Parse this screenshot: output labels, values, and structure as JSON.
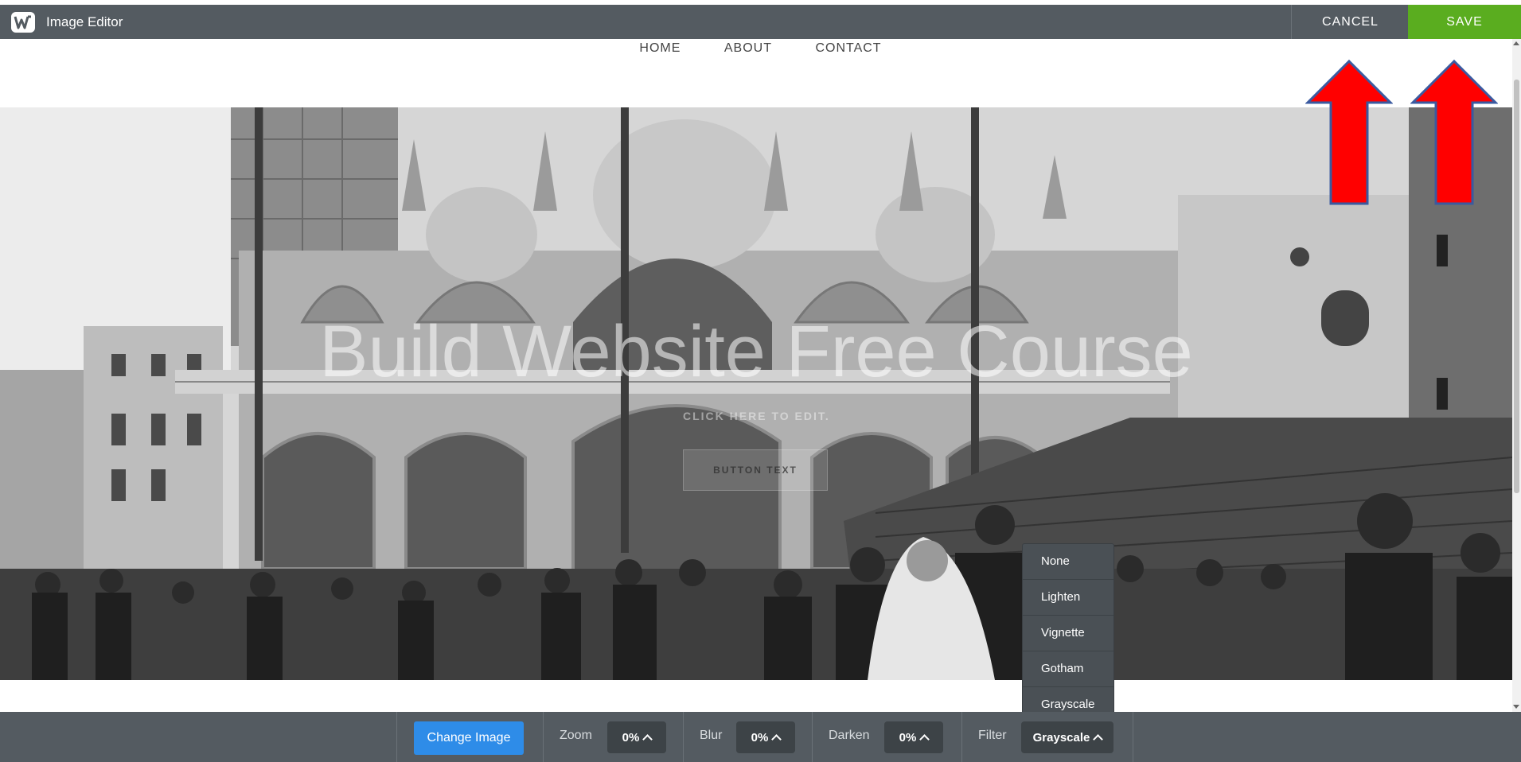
{
  "app": {
    "title": "Image Editor",
    "logo_icon": "weebly-logo-icon"
  },
  "header": {
    "cancel_label": "CANCEL",
    "save_label": "SAVE",
    "save_color": "#5aad1f",
    "bar_color": "#545b61"
  },
  "site_nav": {
    "items": [
      "HOME",
      "ABOUT",
      "CONTACT"
    ]
  },
  "hero": {
    "title": "Build Website Free Course",
    "subtitle": "CLICK HERE TO EDIT.",
    "button_text": "BUTTON TEXT"
  },
  "toolbar": {
    "change_image_label": "Change Image",
    "change_image_color": "#2e8ce8",
    "zoom": {
      "label": "Zoom",
      "value": "0%"
    },
    "blur": {
      "label": "Blur",
      "value": "0%"
    },
    "darken": {
      "label": "Darken",
      "value": "0%"
    },
    "filter": {
      "label": "Filter",
      "value": "Grayscale"
    }
  },
  "filter_menu": {
    "options": [
      "None",
      "Lighten",
      "Vignette",
      "Gotham",
      "Grayscale"
    ]
  },
  "annotations": {
    "arrow_color": "#ff0000",
    "arrow_outline": "#3a5aa0"
  }
}
